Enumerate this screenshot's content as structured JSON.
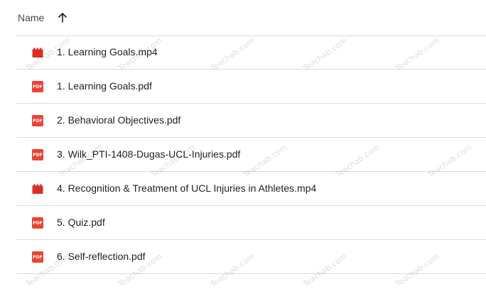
{
  "header": {
    "name_label": "Name",
    "sort_icon": "arrow-up-icon"
  },
  "files": [
    {
      "name": "1. Learning Goals.mp4",
      "type": "video",
      "icon": "video-file-icon"
    },
    {
      "name": "1. Learning Goals.pdf",
      "type": "pdf",
      "icon": "pdf-file-icon"
    },
    {
      "name": "2. Behavioral Objectives.pdf",
      "type": "pdf",
      "icon": "pdf-file-icon"
    },
    {
      "name": "3. Wilk_PTI-1408-Dugas-UCL-Injuries.pdf",
      "type": "pdf",
      "icon": "pdf-file-icon"
    },
    {
      "name": "4. Recognition & Treatment of UCL Injuries in Athletes.mp4",
      "type": "video",
      "icon": "video-file-icon"
    },
    {
      "name": "5. Quiz.pdf",
      "type": "pdf",
      "icon": "pdf-file-icon"
    },
    {
      "name": "6. Self-reflection.pdf",
      "type": "pdf",
      "icon": "pdf-file-icon"
    }
  ],
  "pdf_badge_text": "PDF",
  "watermark_text": "Teachab.com",
  "colors": {
    "pdf_red": "#ea4335",
    "video_red": "#d93025",
    "divider": "#dadce0",
    "text": "#1f1f1f"
  }
}
